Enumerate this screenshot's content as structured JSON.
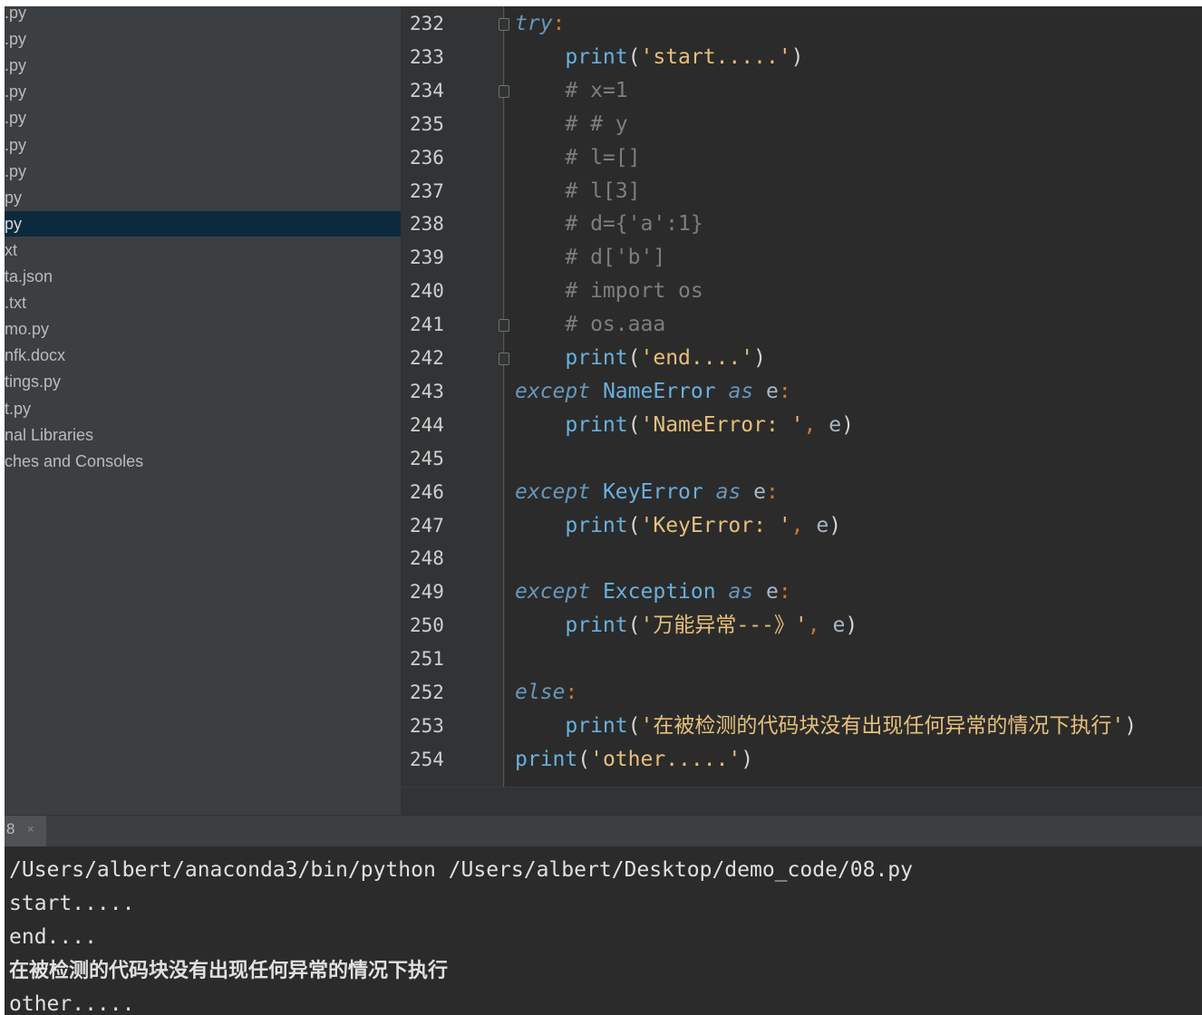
{
  "project_tree": {
    "items": [
      {
        "label": ".py",
        "selected": false
      },
      {
        "label": ".py",
        "selected": false
      },
      {
        "label": ".py",
        "selected": false
      },
      {
        "label": ".py",
        "selected": false
      },
      {
        "label": ".py",
        "selected": false
      },
      {
        "label": ".py",
        "selected": false
      },
      {
        "label": ".py",
        "selected": false
      },
      {
        "label": "py",
        "selected": false
      },
      {
        "label": "py",
        "selected": true
      },
      {
        "label": "xt",
        "selected": false
      },
      {
        "label": "ta.json",
        "selected": false
      },
      {
        "label": ".txt",
        "selected": false
      },
      {
        "label": "mo.py",
        "selected": false
      },
      {
        "label": "nfk.docx",
        "selected": false
      },
      {
        "label": "tings.py",
        "selected": false
      },
      {
        "label": "t.py",
        "selected": false
      },
      {
        "label": "nal Libraries",
        "selected": false
      },
      {
        "label": "ches and Consoles",
        "selected": false
      }
    ]
  },
  "editor": {
    "lines": [
      {
        "num": "232",
        "fold": true,
        "tokens": [
          {
            "c": "kw",
            "t": "try"
          },
          {
            "c": "pu",
            "t": ":"
          }
        ]
      },
      {
        "num": "233",
        "fold": false,
        "tokens": [
          {
            "c": "id",
            "t": "    "
          },
          {
            "c": "fn",
            "t": "print"
          },
          {
            "c": "par",
            "t": "("
          },
          {
            "c": "str",
            "t": "'start.....'"
          },
          {
            "c": "par",
            "t": ")"
          }
        ]
      },
      {
        "num": "234",
        "fold": true,
        "tokens": [
          {
            "c": "id",
            "t": "    "
          },
          {
            "c": "cmt",
            "t": "# x=1"
          }
        ]
      },
      {
        "num": "235",
        "fold": false,
        "tokens": [
          {
            "c": "id",
            "t": "    "
          },
          {
            "c": "cmt",
            "t": "# # y"
          }
        ]
      },
      {
        "num": "236",
        "fold": false,
        "tokens": [
          {
            "c": "id",
            "t": "    "
          },
          {
            "c": "cmt",
            "t": "# l=[]"
          }
        ]
      },
      {
        "num": "237",
        "fold": false,
        "tokens": [
          {
            "c": "id",
            "t": "    "
          },
          {
            "c": "cmt",
            "t": "# l[3]"
          }
        ]
      },
      {
        "num": "238",
        "fold": false,
        "tokens": [
          {
            "c": "id",
            "t": "    "
          },
          {
            "c": "cmt",
            "t": "# d={'a':1}"
          }
        ]
      },
      {
        "num": "239",
        "fold": false,
        "tokens": [
          {
            "c": "id",
            "t": "    "
          },
          {
            "c": "cmt",
            "t": "# d['b']"
          }
        ]
      },
      {
        "num": "240",
        "fold": false,
        "tokens": [
          {
            "c": "id",
            "t": "    "
          },
          {
            "c": "cmt",
            "t": "# import os"
          }
        ]
      },
      {
        "num": "241",
        "fold": true,
        "tokens": [
          {
            "c": "id",
            "t": "    "
          },
          {
            "c": "cmt",
            "t": "# os.aaa"
          }
        ]
      },
      {
        "num": "242",
        "fold": true,
        "tokens": [
          {
            "c": "id",
            "t": "    "
          },
          {
            "c": "fn",
            "t": "print"
          },
          {
            "c": "par",
            "t": "("
          },
          {
            "c": "str",
            "t": "'end....'"
          },
          {
            "c": "par",
            "t": ")"
          }
        ]
      },
      {
        "num": "243",
        "fold": false,
        "tokens": [
          {
            "c": "kw",
            "t": "except"
          },
          {
            "c": "id",
            "t": " "
          },
          {
            "c": "cls",
            "t": "NameError"
          },
          {
            "c": "id",
            "t": " "
          },
          {
            "c": "kw",
            "t": "as"
          },
          {
            "c": "id",
            "t": " e"
          },
          {
            "c": "pu",
            "t": ":"
          }
        ]
      },
      {
        "num": "244",
        "fold": false,
        "tokens": [
          {
            "c": "id",
            "t": "    "
          },
          {
            "c": "fn",
            "t": "print"
          },
          {
            "c": "par",
            "t": "("
          },
          {
            "c": "str",
            "t": "'NameError: '"
          },
          {
            "c": "pu",
            "t": ","
          },
          {
            "c": "id",
            "t": " e"
          },
          {
            "c": "par",
            "t": ")"
          }
        ]
      },
      {
        "num": "245",
        "fold": false,
        "tokens": []
      },
      {
        "num": "246",
        "fold": false,
        "tokens": [
          {
            "c": "kw",
            "t": "except"
          },
          {
            "c": "id",
            "t": " "
          },
          {
            "c": "cls",
            "t": "KeyError"
          },
          {
            "c": "id",
            "t": " "
          },
          {
            "c": "kw",
            "t": "as"
          },
          {
            "c": "id",
            "t": " e"
          },
          {
            "c": "pu",
            "t": ":"
          }
        ]
      },
      {
        "num": "247",
        "fold": false,
        "tokens": [
          {
            "c": "id",
            "t": "    "
          },
          {
            "c": "fn",
            "t": "print"
          },
          {
            "c": "par",
            "t": "("
          },
          {
            "c": "str",
            "t": "'KeyError: '"
          },
          {
            "c": "pu",
            "t": ","
          },
          {
            "c": "id",
            "t": " e"
          },
          {
            "c": "par",
            "t": ")"
          }
        ]
      },
      {
        "num": "248",
        "fold": false,
        "tokens": []
      },
      {
        "num": "249",
        "fold": false,
        "tokens": [
          {
            "c": "kw",
            "t": "except"
          },
          {
            "c": "id",
            "t": " "
          },
          {
            "c": "cls",
            "t": "Exception"
          },
          {
            "c": "id",
            "t": " "
          },
          {
            "c": "kw",
            "t": "as"
          },
          {
            "c": "id",
            "t": " e"
          },
          {
            "c": "pu",
            "t": ":"
          }
        ]
      },
      {
        "num": "250",
        "fold": false,
        "tokens": [
          {
            "c": "id",
            "t": "    "
          },
          {
            "c": "fn",
            "t": "print"
          },
          {
            "c": "par",
            "t": "("
          },
          {
            "c": "str",
            "t": "'万能异常---》'"
          },
          {
            "c": "pu",
            "t": ","
          },
          {
            "c": "id",
            "t": " e"
          },
          {
            "c": "par",
            "t": ")"
          }
        ]
      },
      {
        "num": "251",
        "fold": false,
        "tokens": []
      },
      {
        "num": "252",
        "fold": false,
        "tokens": [
          {
            "c": "kw",
            "t": "else"
          },
          {
            "c": "pu",
            "t": ":"
          }
        ]
      },
      {
        "num": "253",
        "fold": false,
        "tokens": [
          {
            "c": "id",
            "t": "    "
          },
          {
            "c": "fn",
            "t": "print"
          },
          {
            "c": "par",
            "t": "("
          },
          {
            "c": "str",
            "t": "'在被检测的代码块没有出现任何异常的情况下执行'"
          },
          {
            "c": "par",
            "t": ")"
          }
        ]
      },
      {
        "num": "254",
        "fold": false,
        "tokens": [
          {
            "c": "fn",
            "t": "print"
          },
          {
            "c": "par",
            "t": "("
          },
          {
            "c": "str",
            "t": "'other.....'"
          },
          {
            "c": "par",
            "t": ")"
          }
        ]
      }
    ]
  },
  "run_panel": {
    "tab_label": "8",
    "tab_close": "×",
    "output": [
      "/Users/albert/anaconda3/bin/python /Users/albert/Desktop/demo_code/08.py",
      "start.....",
      "end....",
      "在被检测的代码块没有出现任何异常的情况下执行",
      "other....."
    ]
  },
  "colors": {
    "editor_bg": "#2b2b2b",
    "sidebar_bg": "#3c3f41",
    "selection_bg": "#0d293e",
    "keyword": "#6897bb",
    "string": "#e5c07b",
    "comment": "#7e7e7e"
  }
}
